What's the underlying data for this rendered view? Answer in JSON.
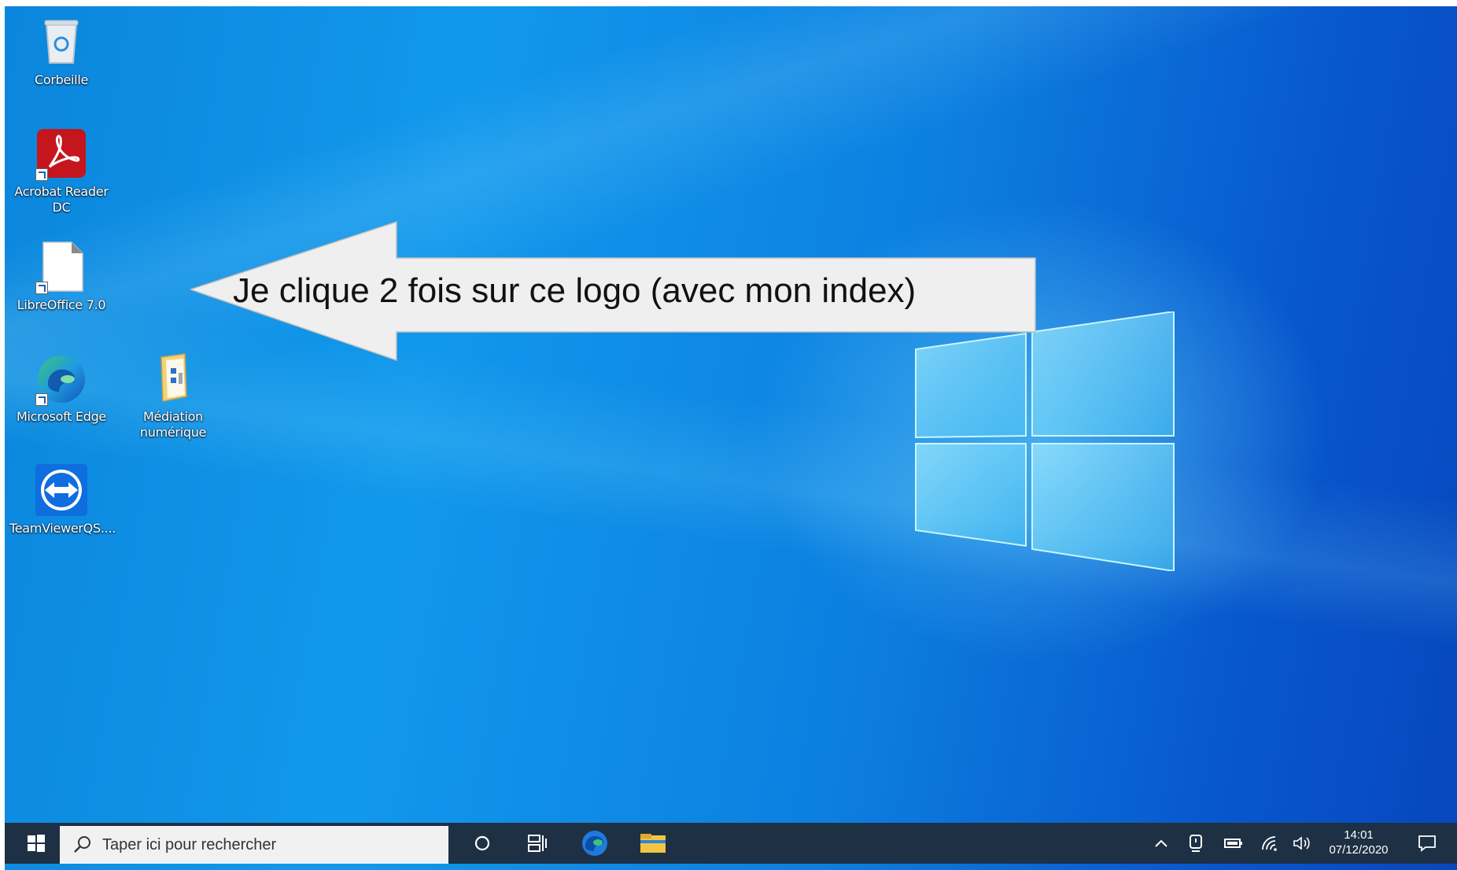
{
  "desktop": {
    "icons": [
      {
        "label": "Corbeille",
        "icon": "recycle-bin-icon"
      },
      {
        "label": "Acrobat Reader DC",
        "icon": "acrobat-reader-icon"
      },
      {
        "label": "LibreOffice 7.0",
        "icon": "libreoffice-icon"
      },
      {
        "label": "Microsoft Edge",
        "icon": "edge-icon"
      },
      {
        "label": "Médiation numérique",
        "icon": "folder-icon"
      },
      {
        "label": "TeamViewerQS....",
        "icon": "teamviewer-icon"
      }
    ]
  },
  "annotation": {
    "text": "Je clique 2 fois sur ce logo (avec mon index)"
  },
  "taskbar": {
    "search_placeholder": "Taper ici pour rechercher",
    "time": "14:01",
    "date": "07/12/2020"
  },
  "colors": {
    "taskbar_bg": "#1e3044",
    "acrobat_red": "#c4161c",
    "teamviewer_blue": "#0e6ee0",
    "edge_blue": "#1f7ae0",
    "edge_green": "#3bc47a"
  }
}
